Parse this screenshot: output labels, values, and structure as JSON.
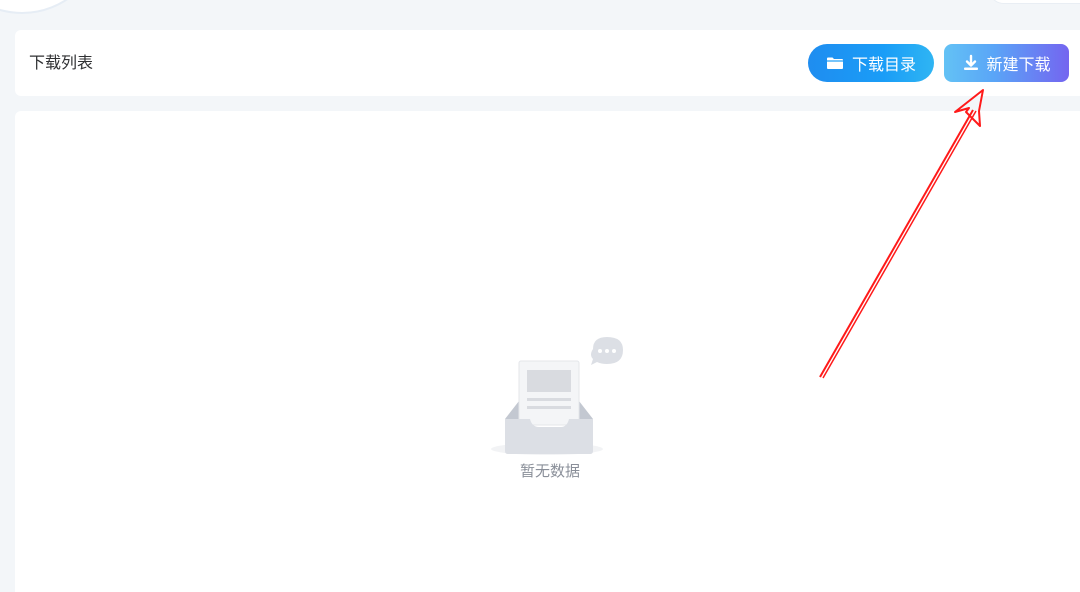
{
  "header": {
    "title": "下载列表",
    "buttons": {
      "download_dir_label": "下载目录",
      "new_download_label": "新建下载"
    }
  },
  "content": {
    "empty_text": "暂无数据"
  },
  "icons": {
    "download_dir": "folder-icon",
    "new_download": "download-icon",
    "empty": "empty-inbox-icon"
  },
  "colors": {
    "accent_blue": "#1a9df7",
    "accent_purple": "#7465f0",
    "annotation_arrow": "#ff1a1a"
  }
}
